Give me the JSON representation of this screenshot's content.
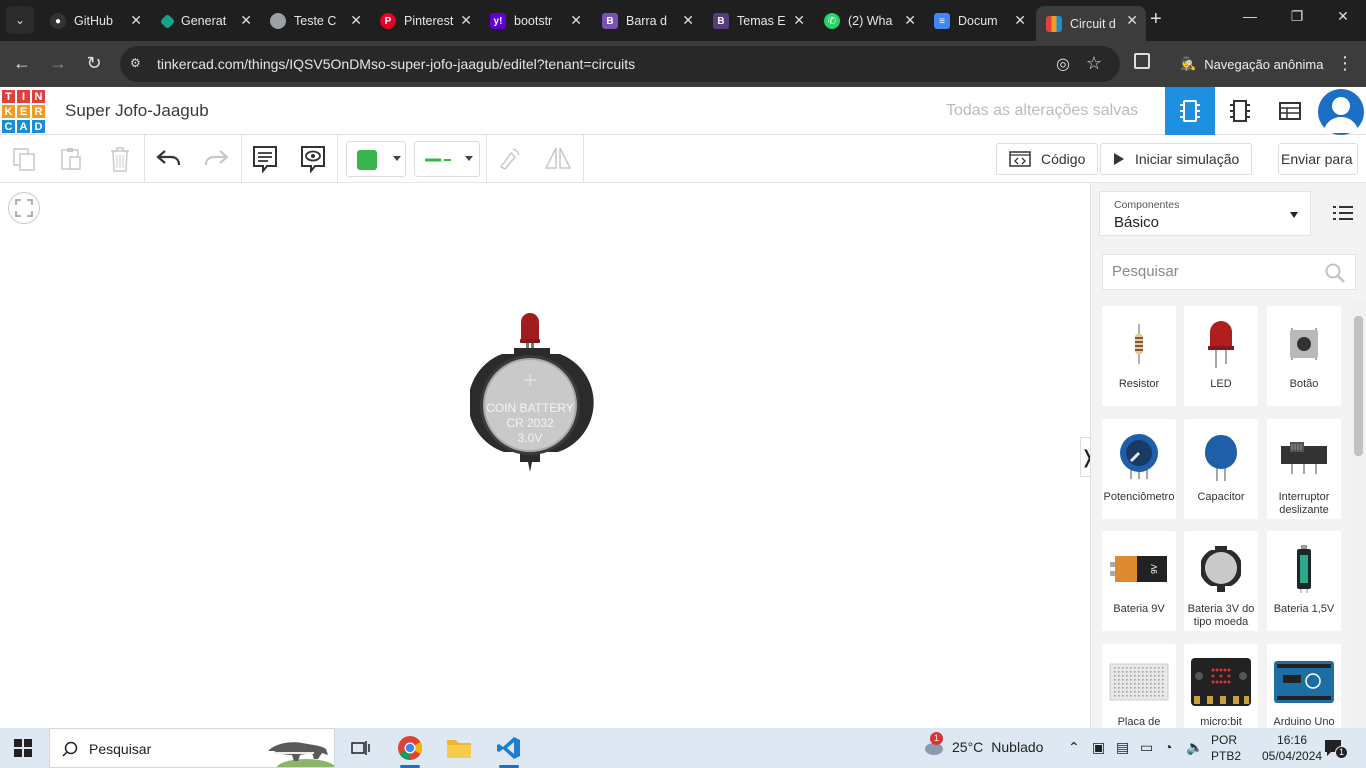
{
  "browser": {
    "tabs": [
      {
        "title": "GitHub",
        "icon": "github-icon",
        "color": "#24292e"
      },
      {
        "title": "Generat",
        "icon": "diamond-icon",
        "color": "#12a58a"
      },
      {
        "title": "Teste C",
        "icon": "globe-icon",
        "color": "#9aa0a6"
      },
      {
        "title": "Pinterest",
        "icon": "pinterest-icon",
        "color": "#e60023"
      },
      {
        "title": "bootstr",
        "icon": "yahoo-icon",
        "color": "#6001d2"
      },
      {
        "title": "Barra d",
        "icon": "bootstrap-icon",
        "color": "#7952b3"
      },
      {
        "title": "Temas E",
        "icon": "bootstrap-icon",
        "color": "#563d7c"
      },
      {
        "title": "(2) Wha",
        "icon": "whatsapp-icon",
        "color": "#25d366"
      },
      {
        "title": "Docum",
        "icon": "docs-icon",
        "color": "#4285f4"
      },
      {
        "title": "Circuit d",
        "icon": "tinkercad-icon",
        "color": "#e8a030",
        "active": true
      }
    ],
    "url": "tinkercad.com/things/IQSV5OnDMso-super-jofo-jaagub/editel?tenant=circuits",
    "incognito_label": "Navegação anônima"
  },
  "app": {
    "logo_letters": [
      "T",
      "I",
      "N",
      "K",
      "E",
      "R",
      "C",
      "A",
      "D"
    ],
    "logo_colors": [
      "#e2403a",
      "#e2403a",
      "#e2403a",
      "#f29c1f",
      "#f29c1f",
      "#f29c1f",
      "#1a8fcf",
      "#1a8fcf",
      "#1a8fcf"
    ],
    "project_title": "Super Jofo-Jaagub",
    "save_status": "Todas as alterações salvas",
    "accent": "#1e8fe1"
  },
  "toolbar": {
    "color_value": "#3ab54a",
    "code_label": "Código",
    "start_sim_label": "Iniciar simulação",
    "send_label": "Enviar para"
  },
  "canvas": {
    "battery_line1": "COIN BATTERY",
    "battery_line2": "CR 2032",
    "battery_line3": "3.0V"
  },
  "panel": {
    "components_label": "Componentes",
    "components_value": "Básico",
    "search_placeholder": "Pesquisar",
    "items": [
      {
        "name": "Resistor",
        "icon": "resistor-icon"
      },
      {
        "name": "LED",
        "icon": "led-icon"
      },
      {
        "name": "Botão",
        "icon": "pushbutton-icon"
      },
      {
        "name": "Potenciômetro",
        "icon": "potentiometer-icon"
      },
      {
        "name": "Capacitor",
        "icon": "capacitor-icon"
      },
      {
        "name": "Interruptor deslizante",
        "icon": "slide-switch-icon"
      },
      {
        "name": "Bateria 9V",
        "icon": "battery-9v-icon"
      },
      {
        "name": "Bateria 3V do tipo moeda",
        "icon": "coin-battery-icon"
      },
      {
        "name": "Bateria 1,5V",
        "icon": "battery-aa-icon"
      },
      {
        "name": "Placa de",
        "icon": "breadboard-icon"
      },
      {
        "name": "micro:bit",
        "icon": "microbit-icon"
      },
      {
        "name": "Arduino Uno",
        "icon": "arduino-icon"
      }
    ]
  },
  "taskbar": {
    "search_placeholder": "Pesquisar",
    "weather_badge": "1",
    "temperature": "25°C",
    "condition": "Nublado",
    "lang_line1": "POR",
    "lang_line2": "PTB2",
    "time": "16:16",
    "date": "05/04/2024",
    "notif_count": "1"
  }
}
